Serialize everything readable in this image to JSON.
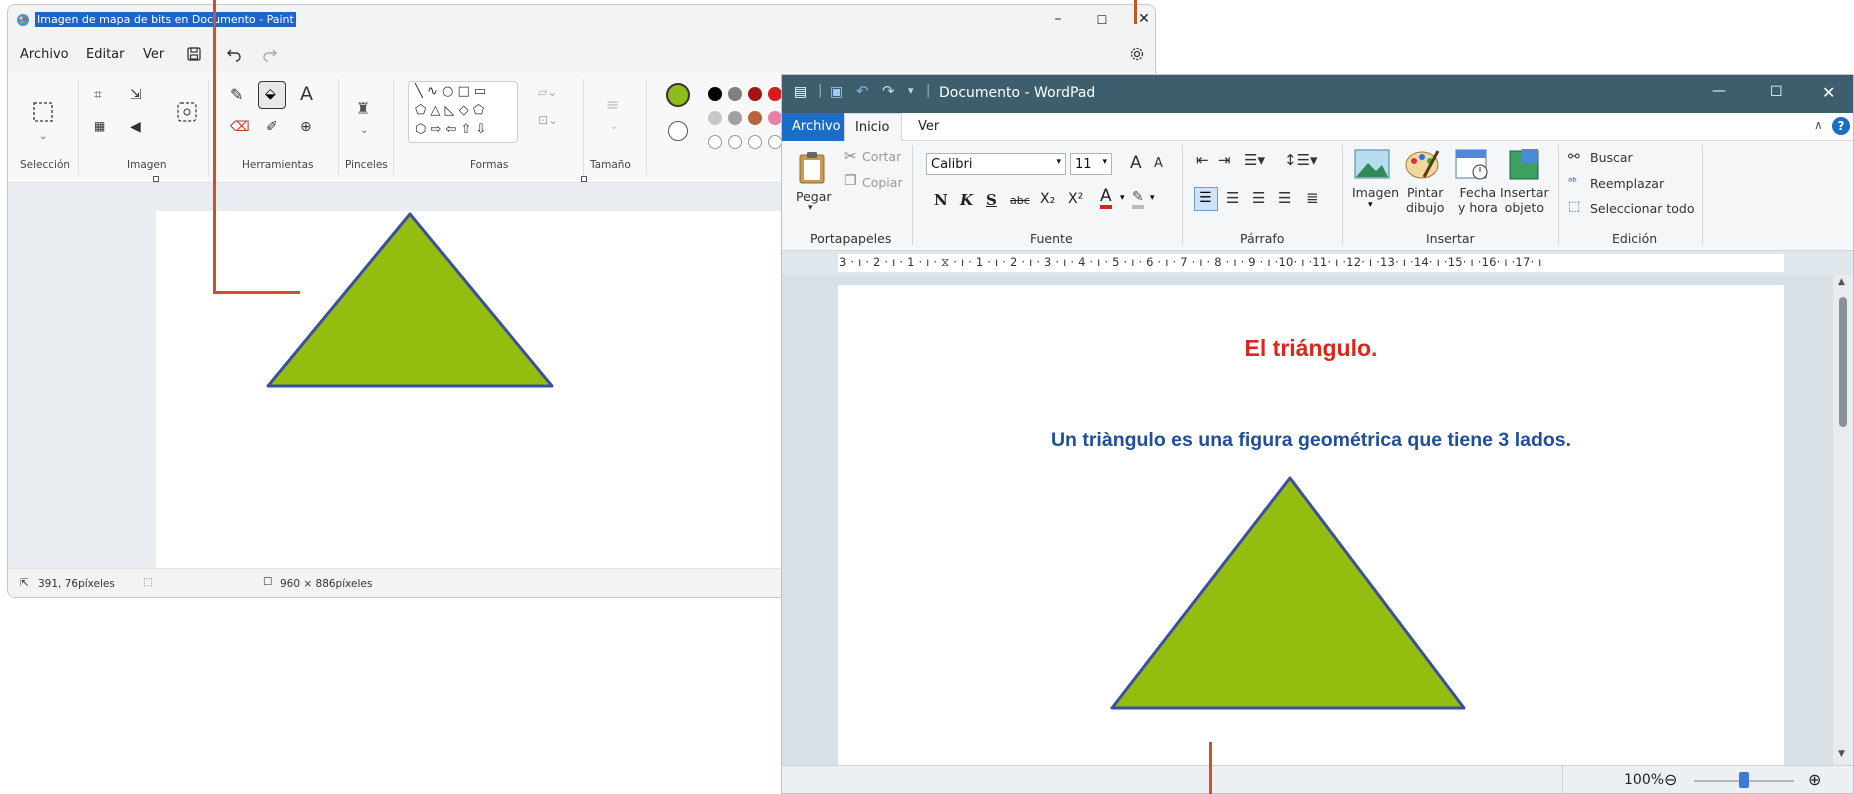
{
  "paint": {
    "title": "Imagen de mapa de bits en Documento - Paint",
    "menu": {
      "file": "Archivo",
      "edit": "Editar",
      "view": "Ver"
    },
    "groups": {
      "selection": "Selección",
      "image": "Imagen",
      "tools": "Herramientas",
      "brushes": "Pinceles",
      "shapes": "Formas",
      "size": "Tamaño"
    },
    "tool_text_glyph": "A",
    "status": {
      "cursor_pos": "391, 76píxeles",
      "canvas_size": "960 × 886píxeles"
    },
    "window_controls": {
      "minimize": "–",
      "maximize": "☐",
      "close": "✕"
    },
    "colors": {
      "primary": "#8cbd1d",
      "palette": [
        "#000000",
        "#7f7f7f",
        "#a31515",
        "#d71a1a",
        "#c8c8c8",
        "#a0a0a0",
        "#b5643c",
        "#e87fa7"
      ]
    },
    "triangle": {
      "fill": "#95bd0f",
      "stroke": "#3b4fa0"
    }
  },
  "wordpad": {
    "title": "Documento - WordPad",
    "tabs": {
      "file": "Archivo",
      "home": "Inicio",
      "view": "Ver"
    },
    "clipboard": {
      "paste": "Pegar",
      "cut": "Cortar",
      "copy": "Copiar",
      "group": "Portapapeles"
    },
    "font": {
      "name": "Calibri",
      "size": "11",
      "group": "Fuente",
      "bold": "N",
      "italic": "K",
      "underline": "S",
      "strike": "abc",
      "subscript": "X₂",
      "superscript": "X²",
      "color_glyph": "A",
      "grow": "A",
      "shrink": "A"
    },
    "paragraph": {
      "group": "Párrafo"
    },
    "insert": {
      "image": "Imagen",
      "paint_l1": "Pintar",
      "paint_l2": "dibujo",
      "date_l1": "Fecha",
      "date_l2": "y hora",
      "object_l1": "Insertar",
      "object_l2": "objeto",
      "group": "Insertar"
    },
    "editing": {
      "find": "Buscar",
      "replace": "Reemplazar",
      "select_all": "Seleccionar todo",
      "group": "Edición"
    },
    "ruler": "3 · ı · 2 · ı · 1 · ı · ⧖ · ı · 1 · ı · 2 · ı · 3 · ı · 4 · ı · 5 · ı · 6 · ı · 7 · ı · 8 · ı · 9 · ı ·10· ı ·11· ı ·12· ı ·13· ı ·14· ı ·15· ı ·16· ı ·17· ı",
    "document": {
      "heading": "El triángulo.",
      "body": "Un triàngulo es una figura geométrica que tiene 3 lados."
    },
    "zoom": "100%",
    "help": "?",
    "window_controls": {
      "minimize": "—",
      "maximize": "☐",
      "close": "✕"
    }
  }
}
